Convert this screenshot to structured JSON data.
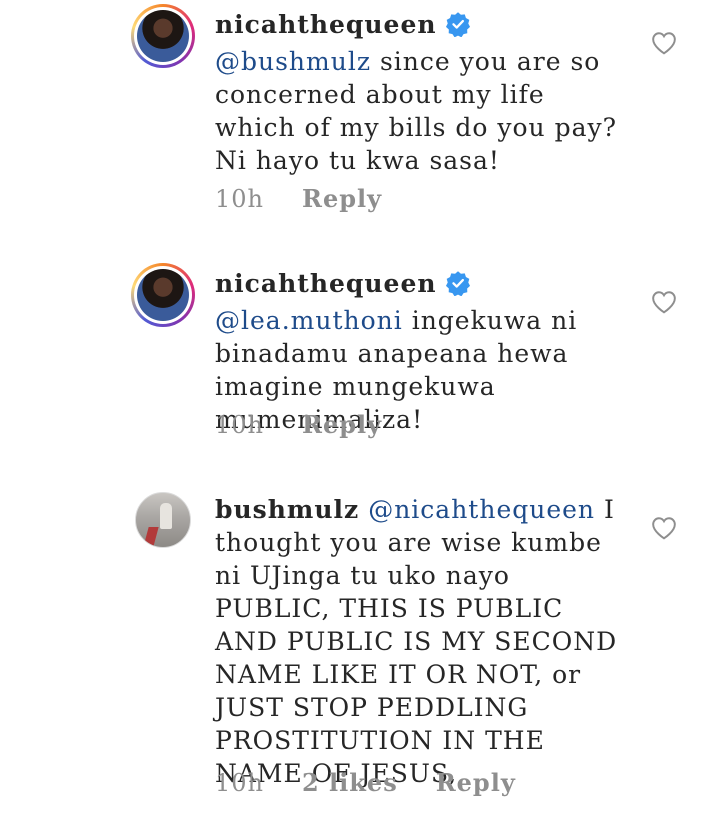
{
  "comments": [
    {
      "username": "nicahthequeen",
      "verified": true,
      "mention": "@bushmulz",
      "text": "since you are so concerned about my life which of my bills do you pay? Ni hayo tu kwa sasa!",
      "time": "10h",
      "likes": "",
      "reply_label": "Reply"
    },
    {
      "username": "nicahthequeen",
      "verified": true,
      "mention": "@lea.muthoni",
      "text": "ingekuwa ni binadamu anapeana hewa imagine mungekuwa mumenimaliza!",
      "time": "10h",
      "likes": "",
      "reply_label": "Reply"
    },
    {
      "username": "bushmulz",
      "verified": false,
      "mention": "@nicahthequeen",
      "text": "I thought you are wise kumbe ni UJinga tu uko nayo PUBLIC, THIS IS PUBLIC AND PUBLIC IS MY SECOND NAME LIKE IT OR NOT, or JUST STOP PEDDLING PROSTITUTION IN THE NAME OF JESUS,",
      "time": "10h",
      "likes": "2 likes",
      "reply_label": "Reply"
    }
  ],
  "icons": {
    "verified": "verified-badge-icon",
    "like": "heart-outline-icon"
  },
  "colors": {
    "verified": "#3897f0",
    "mention": "#1e4b8a",
    "meta": "#8e8e8e"
  }
}
